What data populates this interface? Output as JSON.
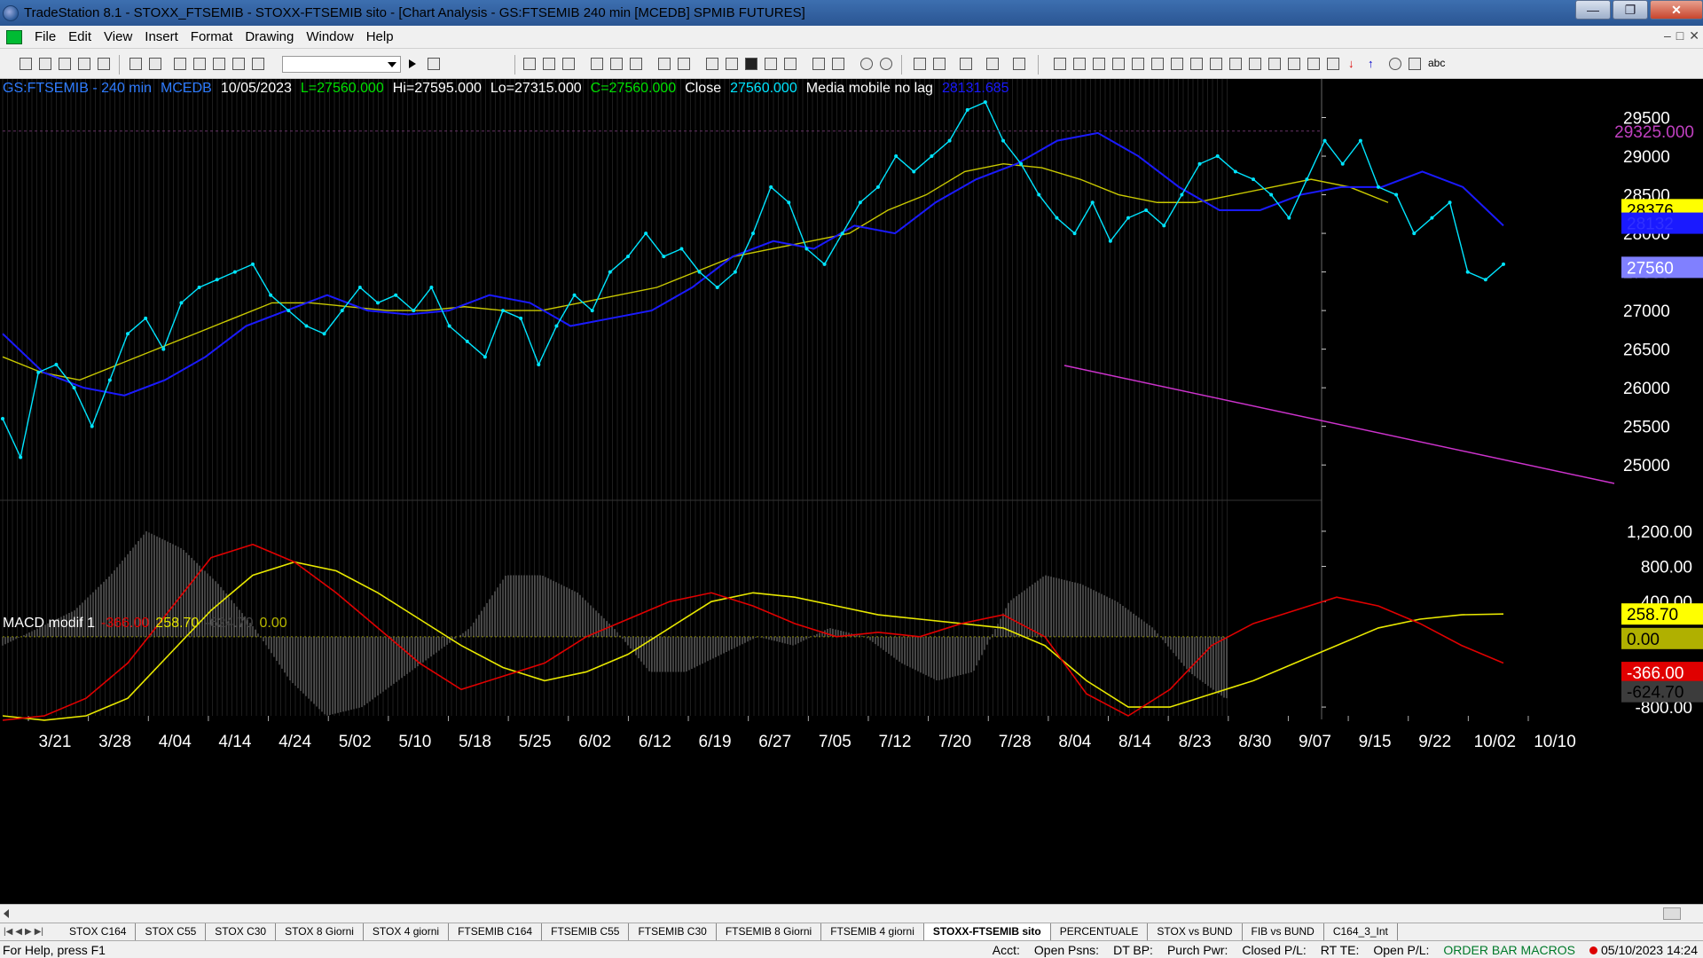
{
  "window": {
    "title": "TradeStation 8.1 - STOXX_FTSEMIB - STOXX-FTSEMIB sito - [Chart Analysis - GS:FTSEMIB  240 min  [MCEDB] SPMIB FUTURES]",
    "minimize": "—",
    "maximize": "❐",
    "close": "✕"
  },
  "menu": {
    "items": [
      "File",
      "Edit",
      "View",
      "Insert",
      "Format",
      "Drawing",
      "Window",
      "Help"
    ],
    "mdi_minimize": "–",
    "mdi_restore": "□",
    "mdi_close": "✕"
  },
  "toolbar": {
    "symbol_value": "",
    "abc_label": "abc"
  },
  "price_header": {
    "symbol": "GS:FTSEMIB - 240 min",
    "feed": "MCEDB",
    "date": "10/05/2023",
    "low": "L=27560.000",
    "high": "Hi=27595.000",
    "lo": "Lo=27315.000",
    "close_val": "C=27560.000",
    "close_label": "Close",
    "close_value": "27560.000",
    "indicator": "Media mobile no lag",
    "indicator_value": "28131.685"
  },
  "macd_header": {
    "name": "MACD modif 1",
    "v1": "-366.00",
    "v2": "258.70",
    "v3": "-624.70",
    "v4": "0.00"
  },
  "colors": {
    "price": "#00e5ff",
    "ma_slow": "#c8c800",
    "ma_fast": "#1a1aff",
    "trendline": "#cc33cc",
    "macd_red": "#e00000",
    "macd_yellow": "#e8e800",
    "histogram": "#808080"
  },
  "chart_data": [
    {
      "type": "line",
      "title": "GS:FTSEMIB - 240 min",
      "ylim": [
        24600,
        30000
      ],
      "y_ticks": [
        25000,
        25500,
        26000,
        26500,
        27000,
        27500,
        28000,
        28500,
        29000,
        29500
      ],
      "x_ticks": [
        "3/21",
        "3/28",
        "4/04",
        "4/14",
        "4/24",
        "5/02",
        "5/10",
        "5/18",
        "5/25",
        "6/02",
        "6/12",
        "6/19",
        "6/27",
        "7/05",
        "7/12",
        "7/20",
        "7/28",
        "8/04",
        "8/14",
        "8/23",
        "8/30",
        "9/07",
        "9/15",
        "9/22",
        "10/02",
        "10/10"
      ],
      "series": [
        {
          "values": [
            25600,
            25100,
            26200,
            26300,
            26000,
            25500,
            26100,
            26700,
            26900,
            26500,
            27100,
            27300,
            27400,
            27500,
            27600,
            27200,
            27000,
            26800,
            26700,
            27000,
            27300,
            27100,
            27200,
            27000,
            27300,
            26800,
            26600,
            26400,
            27000,
            26900,
            26300,
            26800,
            27200,
            27000,
            27500,
            27700,
            28000,
            27700,
            27800,
            27500,
            27300,
            27500,
            28000,
            28600,
            28400,
            27800,
            27600,
            28000,
            28400,
            28600,
            29000,
            28800,
            29000,
            29200,
            29600,
            29700,
            29200,
            28900,
            28500,
            28200,
            28000,
            28400,
            27900,
            28200,
            28300,
            28100,
            28500,
            28900,
            29000,
            28800,
            28700,
            28500,
            28200,
            28700,
            29200,
            28900,
            29200,
            28600,
            28500,
            28000,
            28200,
            28400,
            27500,
            27400,
            27600
          ]
        },
        {
          "values": [
            26400,
            26200,
            26100,
            26300,
            26500,
            26700,
            26900,
            27100,
            27100,
            27050,
            27000,
            27000,
            27050,
            27000,
            27000,
            27100,
            27200,
            27300,
            27500,
            27700,
            27800,
            27900,
            28000,
            28300,
            28500,
            28800,
            28900,
            28850,
            28700,
            28500,
            28400,
            28400,
            28500,
            28600,
            28700,
            28600,
            28400
          ]
        },
        {
          "values": [
            26700,
            26200,
            26000,
            25900,
            26100,
            26400,
            26800,
            27000,
            27200,
            27000,
            26950,
            27000,
            27200,
            27100,
            26800,
            26900,
            27000,
            27300,
            27700,
            27900,
            27800,
            28100,
            28000,
            28400,
            28700,
            28900,
            29200,
            29300,
            29000,
            28600,
            28300,
            28300,
            28500,
            28600,
            28600,
            28800,
            28600,
            28100
          ]
        }
      ],
      "annotations": [
        "29325.000",
        "28376",
        "28132",
        "27560"
      ]
    },
    {
      "type": "line",
      "title": "MACD modif 1",
      "ylim": [
        -900,
        1300
      ],
      "y_ticks": [
        "1,200.00",
        "800.00",
        "400.00",
        "-800.00"
      ],
      "series": [
        {
          "values": [
            -950,
            -900,
            -700,
            -300,
            300,
            900,
            1050,
            850,
            500,
            100,
            -300,
            -600,
            -450,
            -300,
            0,
            200,
            400,
            500,
            350,
            150,
            0,
            50,
            0,
            150,
            250,
            0,
            -650,
            -900,
            -600,
            -100,
            150,
            300,
            450,
            350,
            150,
            -100,
            -300
          ]
        },
        {
          "values": [
            -900,
            -950,
            -900,
            -700,
            -200,
            300,
            700,
            850,
            750,
            500,
            200,
            -100,
            -350,
            -500,
            -400,
            -200,
            100,
            400,
            500,
            450,
            350,
            250,
            200,
            150,
            100,
            -100,
            -500,
            -800,
            -800,
            -650,
            -500,
            -300,
            -100,
            100,
            200,
            250,
            258.7
          ]
        },
        {
          "values": [
            -100,
            100,
            300,
            700,
            1200,
            1000,
            600,
            100,
            -500,
            -900,
            -800,
            -500,
            -200,
            100,
            700,
            700,
            500,
            100,
            -400,
            -400,
            -200,
            0,
            -100,
            100,
            0,
            -300,
            -500,
            -400,
            400,
            700,
            600,
            400,
            100,
            -400,
            -700
          ]
        }
      ],
      "annotations": [
        "258.70",
        "0.00",
        "-366.00",
        "-624.70"
      ]
    }
  ],
  "tabs": [
    "STOX C164",
    "STOX C55",
    "STOX  C30",
    "STOX  8 Giorni",
    "STOX 4 giorni",
    "FTSEMIB C164",
    "FTSEMIB C55",
    "FTSEMIB C30",
    "FTSEMIB  8 Giorni",
    "FTSEMIB  4 giorni",
    "STOXX-FTSEMIB sito",
    "PERCENTUALE",
    "STOX vs BUND",
    "FIB vs BUND",
    "C164_3_Int"
  ],
  "tab_nav": [
    "|◀",
    "◀",
    "▶",
    "▶|"
  ],
  "status": {
    "help": "For Help, press F1",
    "acct": "Acct:",
    "open_psns": "Open Psns:",
    "dt_bp": "DT BP:",
    "purch_pwr": "Purch Pwr:",
    "closed_pl": "Closed P/L:",
    "rt_te": "RT TE:",
    "open_pl": "Open P/L:",
    "order_bar": "ORDER BAR  MACROS",
    "datetime": "05/10/2023 14:24"
  }
}
